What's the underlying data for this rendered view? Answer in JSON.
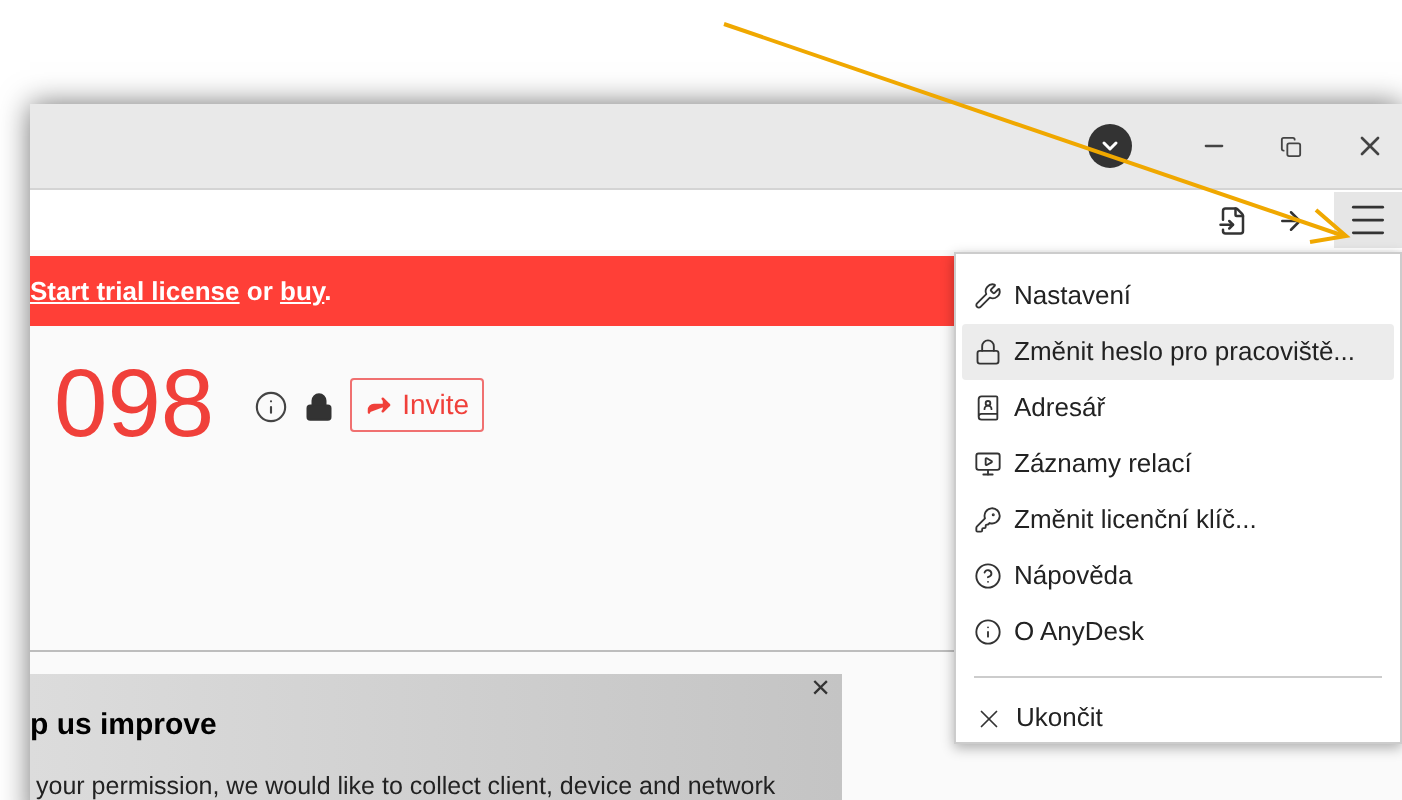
{
  "banner": {
    "link": "Start trial license",
    "middle": " or ",
    "link2": "buy",
    "end": "."
  },
  "address": {
    "id": "098",
    "invite": "Invite"
  },
  "feedback": {
    "title": "p us improve",
    "text": "your permission, we would like to collect client, device and network",
    "close": "×"
  },
  "menu": {
    "items": [
      {
        "label": "Nastavení",
        "selected": false
      },
      {
        "label": "Změnit heslo pro pracoviště...",
        "selected": true
      },
      {
        "label": "Adresář",
        "selected": false
      },
      {
        "label": "Záznamy relací",
        "selected": false
      },
      {
        "label": "Změnit licenční klíč...",
        "selected": false
      },
      {
        "label": "Nápověda",
        "selected": false
      },
      {
        "label": "O AnyDesk",
        "selected": false
      }
    ],
    "exit": "Ukončit"
  }
}
